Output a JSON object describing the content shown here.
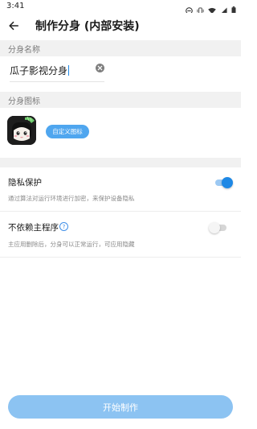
{
  "status_bar": {
    "time": "3:41"
  },
  "app_bar": {
    "title": "制作分身 (内部安装)"
  },
  "name_section": {
    "header": "分身名称",
    "input_value": "瓜子影视分身"
  },
  "icon_section": {
    "header": "分身图标",
    "custom_button_label": "自定义图标"
  },
  "privacy": {
    "title": "隐私保护",
    "description": "通过算法对运行环境进行加密，来保护设备隐私",
    "enabled": true
  },
  "independent": {
    "title": "不依赖主程序",
    "description": "主应用删除后，分身可以正常运行，可应用隐藏",
    "enabled": false
  },
  "start_button_label": "开始制作",
  "colors": {
    "accent": "#1e88e5",
    "button": "#8cc3f2",
    "section_bg": "#f1f1f1"
  }
}
